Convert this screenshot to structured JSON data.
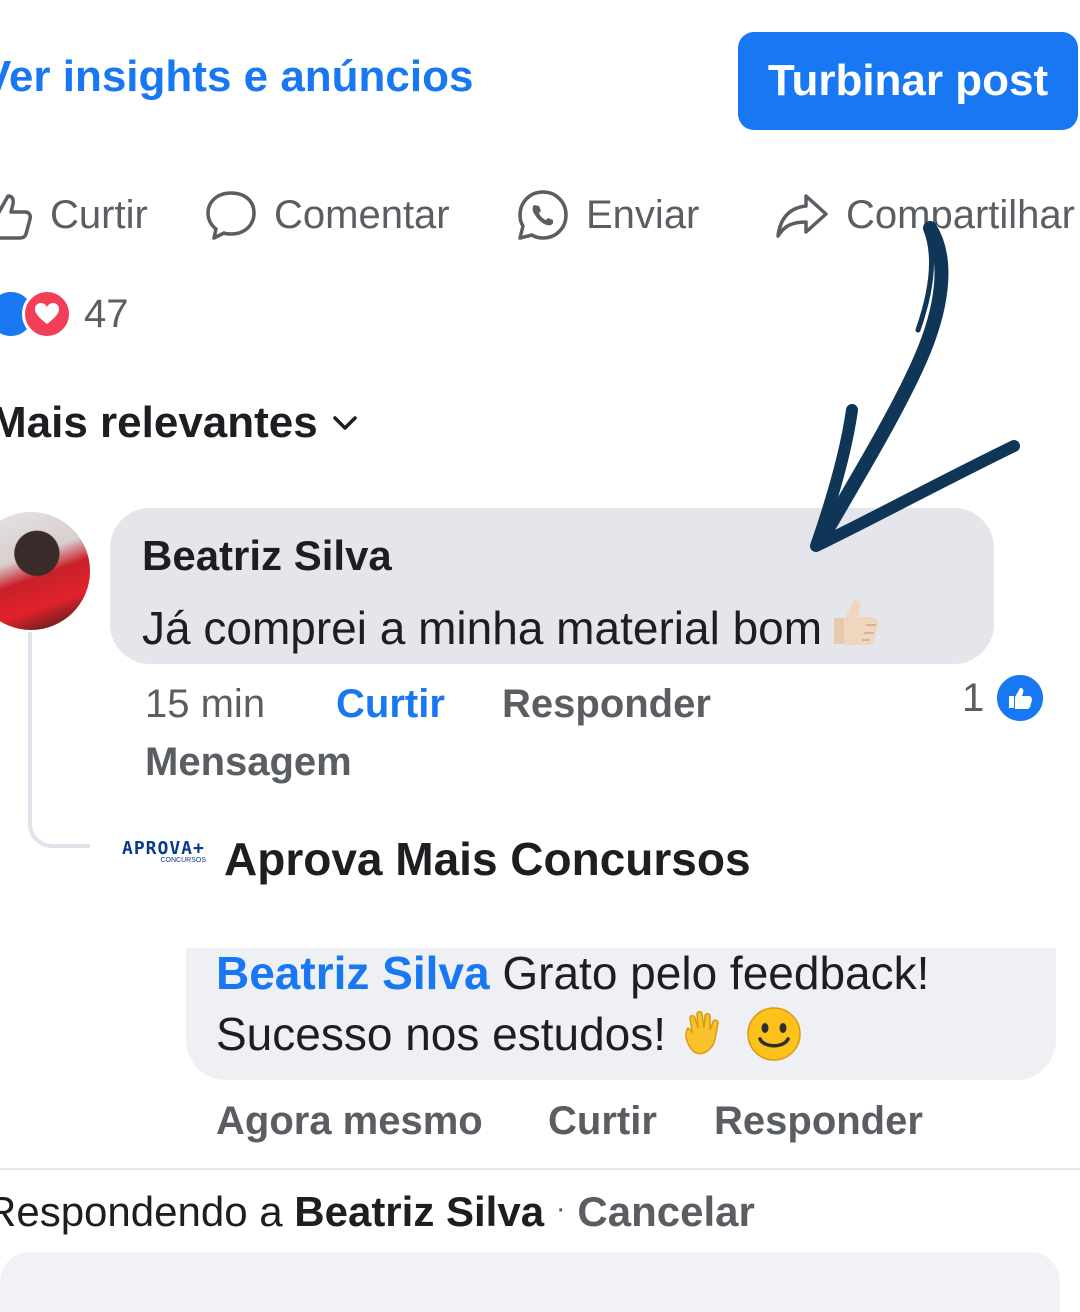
{
  "header": {
    "insights_link": "Ver insights e anúncios",
    "boost_button": "Turbinar post"
  },
  "actions": {
    "like": "Curtir",
    "comment": "Comentar",
    "send": "Enviar",
    "share": "Compartilhar"
  },
  "reactions": {
    "count": "47"
  },
  "sort": {
    "label": "Mais relevantes"
  },
  "comment": {
    "author": "Beatriz Silva",
    "text": "Já comprei a minha material bom",
    "time": "15 min",
    "like": "Curtir",
    "reply": "Responder",
    "message": "Mensagem",
    "like_count": "1"
  },
  "reply": {
    "page_name": "Aprova Mais Concursos",
    "logo_text": "APROVA+",
    "logo_sub": "CONCURSOS",
    "mention": "Beatriz Silva",
    "text_line1": "Grato pelo feedback!",
    "text_line2": "Sucesso nos estudos!",
    "time": "Agora mesmo",
    "like": "Curtir",
    "reply": "Responder"
  },
  "replying_bar": {
    "prefix": "Respondendo a",
    "name": "Beatriz Silva",
    "separator": "·",
    "cancel": "Cancelar"
  },
  "colors": {
    "brand_blue": "#1877f2",
    "annotation_arrow": "#0f3557",
    "bubble_gray": "#e4e6eb"
  }
}
